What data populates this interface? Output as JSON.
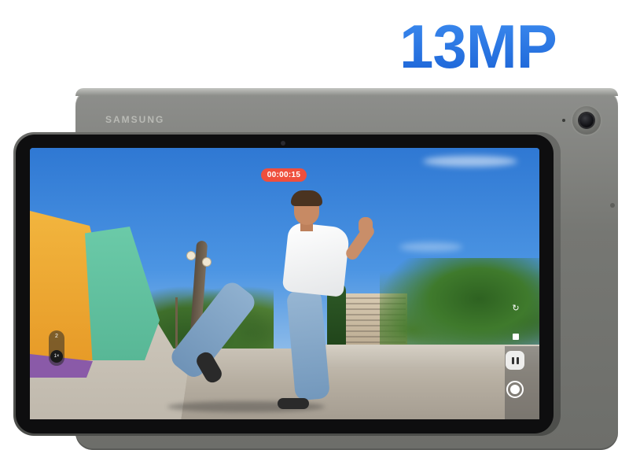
{
  "headline": {
    "text": "13MP"
  },
  "device": {
    "brand": "SAMSUNG"
  },
  "camera_ui": {
    "recording_timer": "00:00:15",
    "zoom_options": [
      "2",
      "1×"
    ],
    "selected_zoom": "1×"
  },
  "icons": [
    "flip-camera-icon",
    "stop-icon",
    "pause-icon",
    "record-icon"
  ],
  "colors": {
    "headline_blue": "#1f6fdc",
    "timer_red": "#ef4f3d",
    "tablet_gray": "#767773"
  }
}
